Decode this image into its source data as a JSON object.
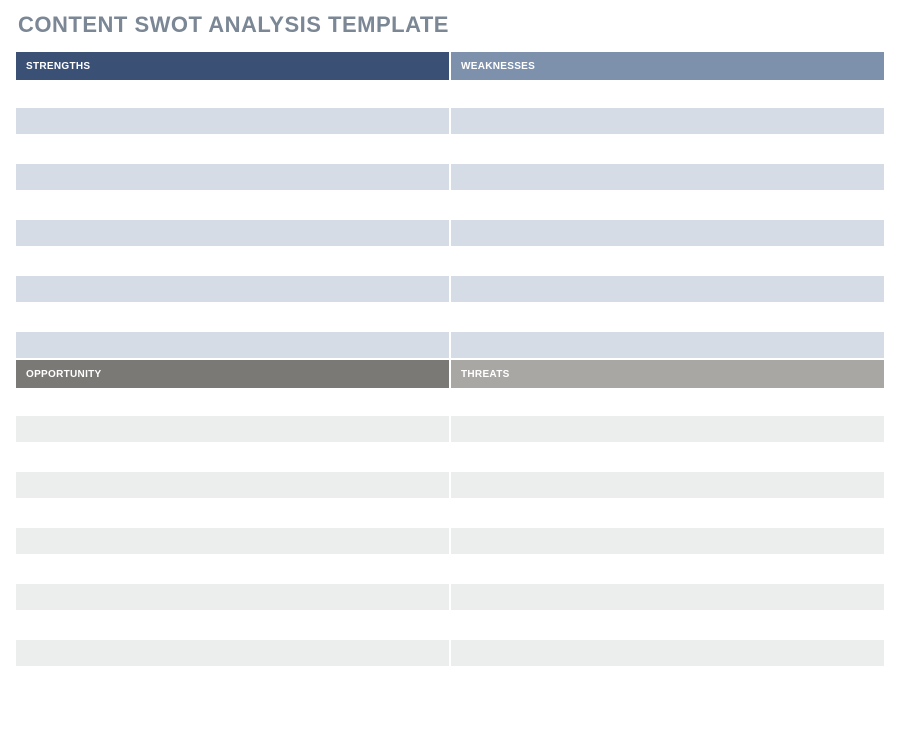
{
  "title": "CONTENT SWOT ANALYSIS TEMPLATE",
  "sections": {
    "top": {
      "left_header": "STRENGTHS",
      "right_header": "WEAKNESSES",
      "rows": [
        {
          "left": "",
          "right": ""
        },
        {
          "left": "",
          "right": ""
        },
        {
          "left": "",
          "right": ""
        },
        {
          "left": "",
          "right": ""
        },
        {
          "left": "",
          "right": ""
        },
        {
          "left": "",
          "right": ""
        },
        {
          "left": "",
          "right": ""
        },
        {
          "left": "",
          "right": ""
        },
        {
          "left": "",
          "right": ""
        },
        {
          "left": "",
          "right": ""
        }
      ]
    },
    "bottom": {
      "left_header": "OPPORTUNITY",
      "right_header": "THREATS",
      "rows": [
        {
          "left": "",
          "right": ""
        },
        {
          "left": "",
          "right": ""
        },
        {
          "left": "",
          "right": ""
        },
        {
          "left": "",
          "right": ""
        },
        {
          "left": "",
          "right": ""
        },
        {
          "left": "",
          "right": ""
        },
        {
          "left": "",
          "right": ""
        },
        {
          "left": "",
          "right": ""
        },
        {
          "left": "",
          "right": ""
        },
        {
          "left": "",
          "right": ""
        }
      ]
    }
  },
  "colors": {
    "title": "#7b8795",
    "strengths_header": "#3a5075",
    "weaknesses_header": "#7d91ad",
    "top_alt_row": "#d6dce6",
    "opportunity_header": "#7b7976",
    "threats_header": "#a9a7a4",
    "bottom_alt_row": "#eceded"
  }
}
